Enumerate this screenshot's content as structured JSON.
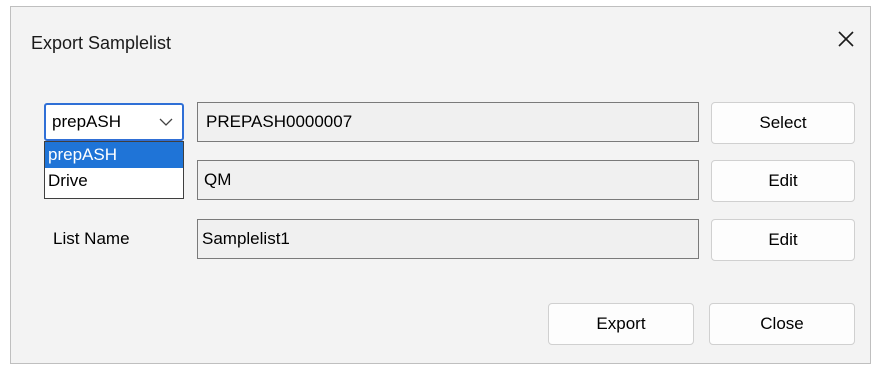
{
  "dialog": {
    "title": "Export Samplelist",
    "close_icon": "close-icon"
  },
  "source": {
    "selected": "prepASH",
    "options": [
      "prepASH",
      "Drive"
    ],
    "highlighted_option": "prepASH",
    "value": "PREPASH0000007",
    "button_label": "Select"
  },
  "folder": {
    "value": "QM",
    "button_label": "Edit"
  },
  "list_name": {
    "label": "List Name",
    "value": "Samplelist1",
    "button_label": "Edit"
  },
  "footer": {
    "export_label": "Export",
    "close_label": "Close"
  }
}
